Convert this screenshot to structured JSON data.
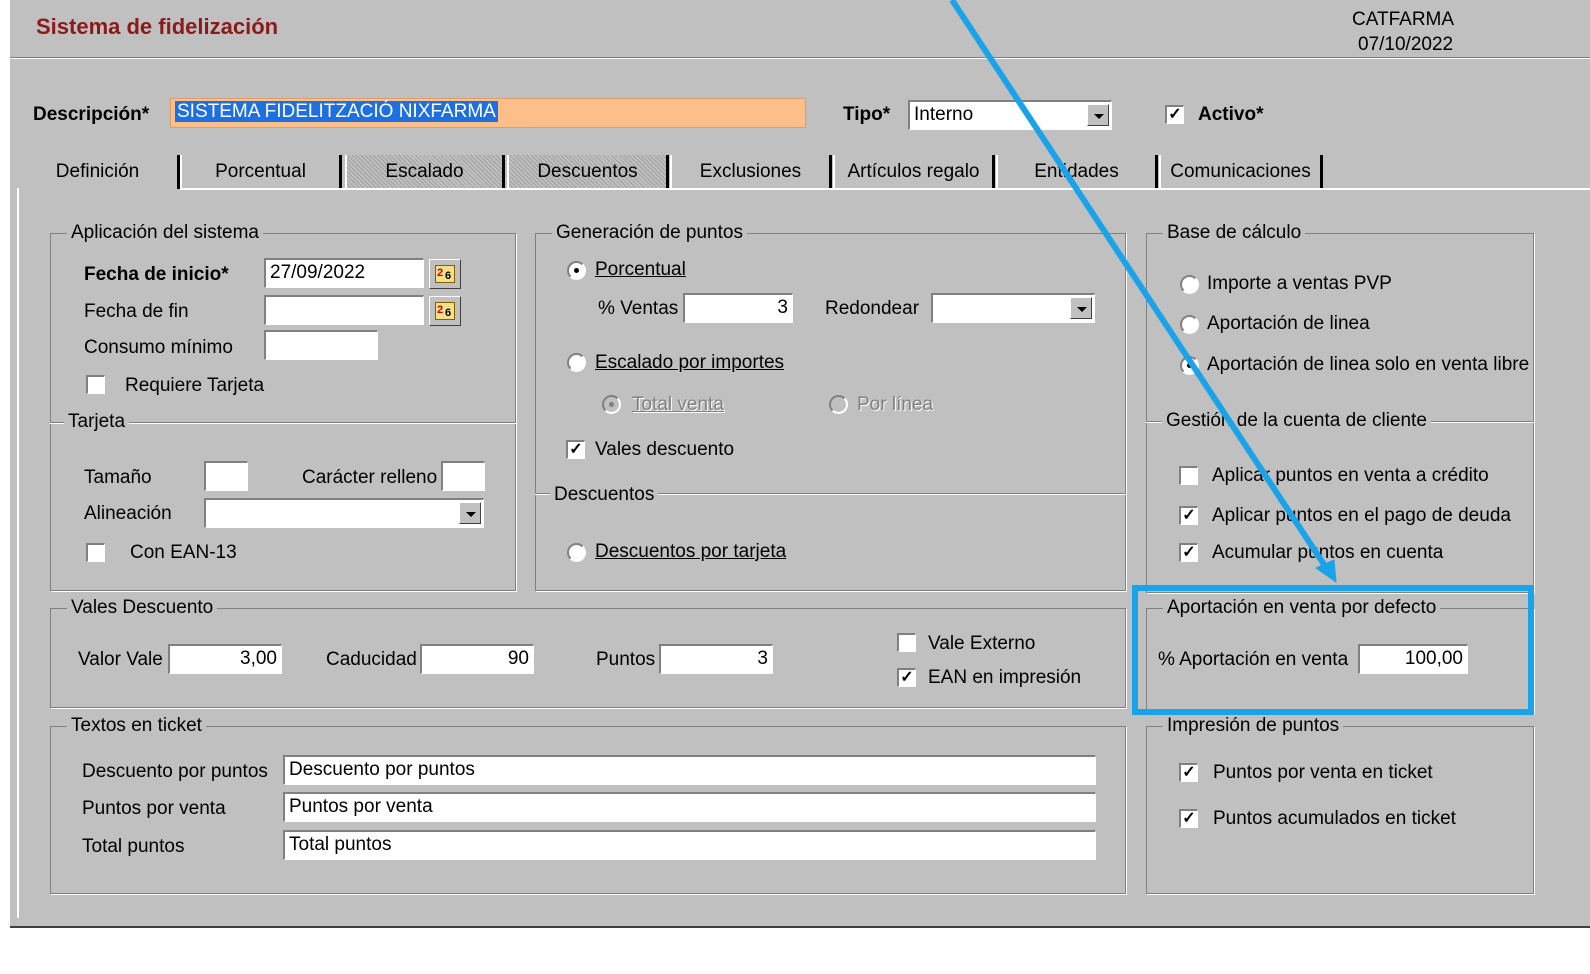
{
  "header": {
    "title": "Sistema de fidelización",
    "company": "CATFARMA",
    "date": "07/10/2022"
  },
  "top": {
    "descripcion_label": "Descripción*",
    "descripcion_value": "SISTEMA FIDELITZACIÓ NIXFARMA",
    "tipo_label": "Tipo*",
    "tipo_value": "Interno",
    "activo_label": "Activo*",
    "activo_checked": true
  },
  "tabs": [
    {
      "label": "Definición",
      "active": true
    },
    {
      "label": "Porcentual"
    },
    {
      "label": "Escalado",
      "disabled": true
    },
    {
      "label": "Descuentos",
      "disabled": true
    },
    {
      "label": "Exclusiones"
    },
    {
      "label": "Artículos regalo"
    },
    {
      "label": "Entidades"
    },
    {
      "label": "Comunicaciones"
    }
  ],
  "aplicacion": {
    "title": "Aplicación del sistema",
    "fecha_inicio_label": "Fecha de inicio*",
    "fecha_inicio_value": "27/09/2022",
    "fecha_fin_label": "Fecha de fin",
    "fecha_fin_value": "",
    "consumo_label": "Consumo mínimo",
    "consumo_value": "",
    "requiere_label": "Requiere Tarjeta"
  },
  "tarjeta": {
    "title": "Tarjeta",
    "tamano_label": "Tamaño",
    "caracter_label": "Carácter relleno",
    "alineacion_label": "Alineación",
    "ean13_label": "Con EAN-13"
  },
  "generacion": {
    "title": "Generación de puntos",
    "porcentual_label": "Porcentual",
    "ventas_label": "% Ventas",
    "ventas_value": "3",
    "redondear_label": "Redondear",
    "escalado_label": "Escalado por importes",
    "total_venta_label": "Total venta",
    "por_linea_label": "Por línea",
    "vales_label": "Vales descuento"
  },
  "descuentos": {
    "title": "Descuentos",
    "tarjeta_label": "Descuentos por tarjeta"
  },
  "base_calculo": {
    "title": "Base de cálculo",
    "options": [
      "Importe a ventas PVP",
      "Aportación de linea",
      "Aportación de linea solo en venta libre"
    ]
  },
  "gestion": {
    "title": "Gestión de la cuenta de cliente",
    "items": [
      {
        "label": "Aplicar puntos en venta a crédito",
        "checked": false
      },
      {
        "label": "Aplicar puntos en el pago de deuda",
        "checked": true
      },
      {
        "label": "Acumular puntos en cuenta",
        "checked": true
      }
    ]
  },
  "vales": {
    "title": "Vales Descuento",
    "valor_label": "Valor Vale",
    "valor_value": "3,00",
    "caducidad_label": "Caducidad",
    "caducidad_value": "90",
    "puntos_label": "Puntos",
    "puntos_value": "3",
    "externo_label": "Vale Externo",
    "ean_label": "EAN en impresión"
  },
  "aportacion": {
    "title": "Aportación en venta por defecto",
    "label": "% Aportación en venta",
    "value": "100,00"
  },
  "textos": {
    "title": "Textos en ticket",
    "rows": [
      {
        "label": "Descuento por puntos",
        "value": "Descuento por puntos"
      },
      {
        "label": "Puntos por venta",
        "value": "Puntos por venta"
      },
      {
        "label": "Total puntos",
        "value": "Total puntos"
      }
    ]
  },
  "impresion": {
    "title": "Impresión de puntos",
    "items": [
      {
        "label": "Puntos por venta en ticket",
        "checked": true
      },
      {
        "label": "Puntos acumulados en ticket",
        "checked": true
      }
    ]
  },
  "annotation": {
    "color": "#1aa3e8"
  }
}
